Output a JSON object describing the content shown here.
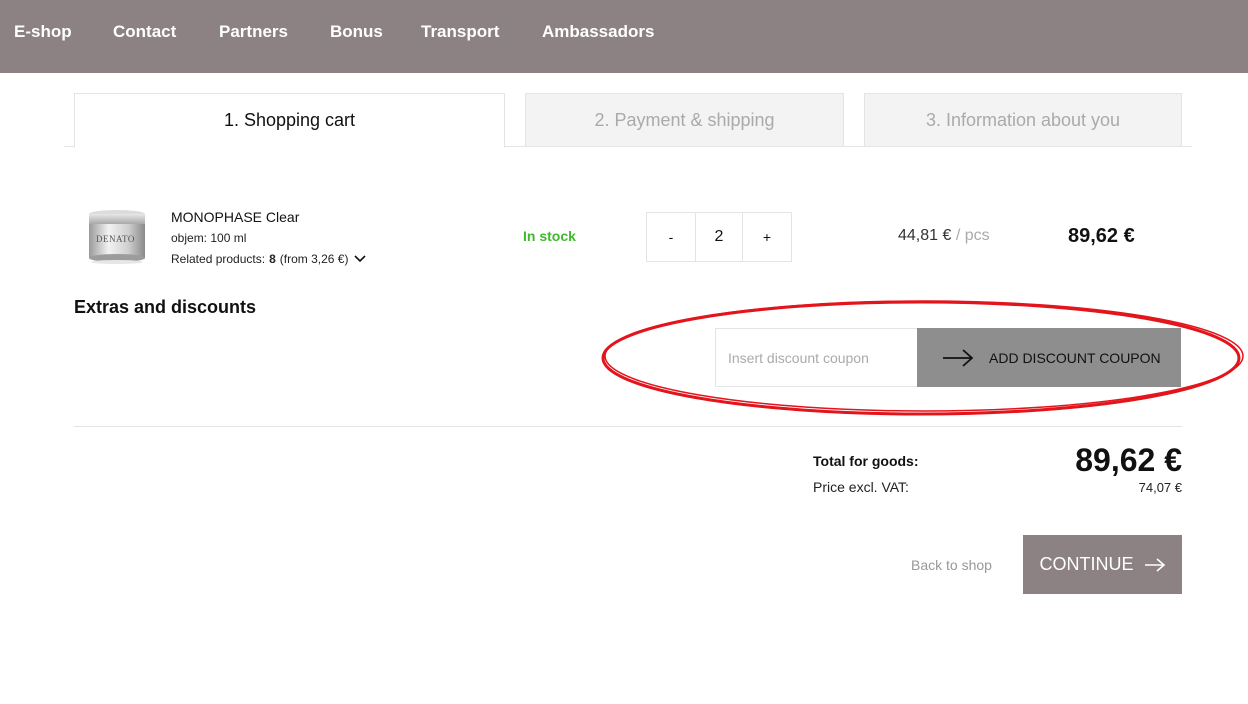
{
  "nav": {
    "items": [
      "E-shop",
      "Contact",
      "Partners",
      "Bonus",
      "Transport",
      "Ambassadors"
    ],
    "bg_color": "#8c8283"
  },
  "steps": [
    {
      "label": "1. Shopping cart",
      "active": true
    },
    {
      "label": "2. Payment & shipping",
      "active": false
    },
    {
      "label": "3. Information about you",
      "active": false
    }
  ],
  "cart_item": {
    "brand_mark": "DENATO",
    "name": "MONOPHASE Clear",
    "volume": "objem: 100 ml",
    "related_label": "Related products:",
    "related_count": "8",
    "related_from": "(from 3,26 €)",
    "stock": "In stock",
    "stock_color": "#3fba2a",
    "qty_minus": "-",
    "quantity": "2",
    "qty_plus": "+",
    "unit_price": "44,81 €",
    "unit_sep": "/",
    "unit": "pcs",
    "line_total": "89,62 €"
  },
  "extras": {
    "title": "Extras and discounts",
    "coupon_placeholder": "Insert discount coupon",
    "coupon_button": "ADD DISCOUNT COUPON"
  },
  "totals": {
    "goods_label": "Total for goods:",
    "goods_value": "89,62 €",
    "excl_label": "Price excl. VAT:",
    "excl_value": "74,07 €"
  },
  "footer": {
    "back_label": "Back to shop",
    "continue_label": "CONTINUE"
  },
  "annotation_color": "#e3141b"
}
